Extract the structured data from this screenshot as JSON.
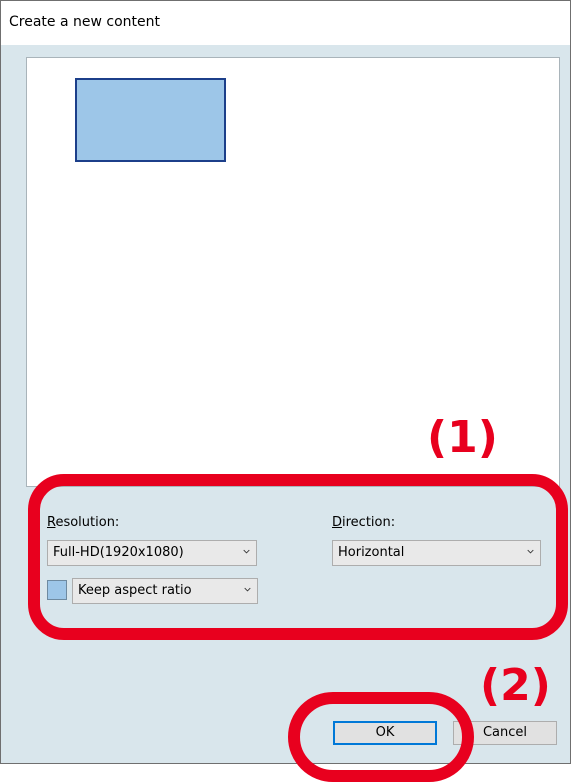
{
  "dialog": {
    "title": "Create a new content",
    "resolution_label_key": "R",
    "resolution_label_rest": "esolution:",
    "direction_label_key": "D",
    "direction_label_rest": "irection:",
    "resolution_value": "Full-HD(1920x1080)",
    "direction_value": "Horizontal",
    "aspect_value": "Keep aspect ratio",
    "ok_label": "OK",
    "cancel_label": "Cancel"
  },
  "annotations": {
    "callout_1": "(1)",
    "callout_2": "(2)"
  },
  "colors": {
    "dialog_bg": "#d9e6ec",
    "preview_fill": "#9dc6e8",
    "preview_border": "#1c3f8a",
    "callout": "#e8001e",
    "ok_focus": "#0078d7"
  }
}
